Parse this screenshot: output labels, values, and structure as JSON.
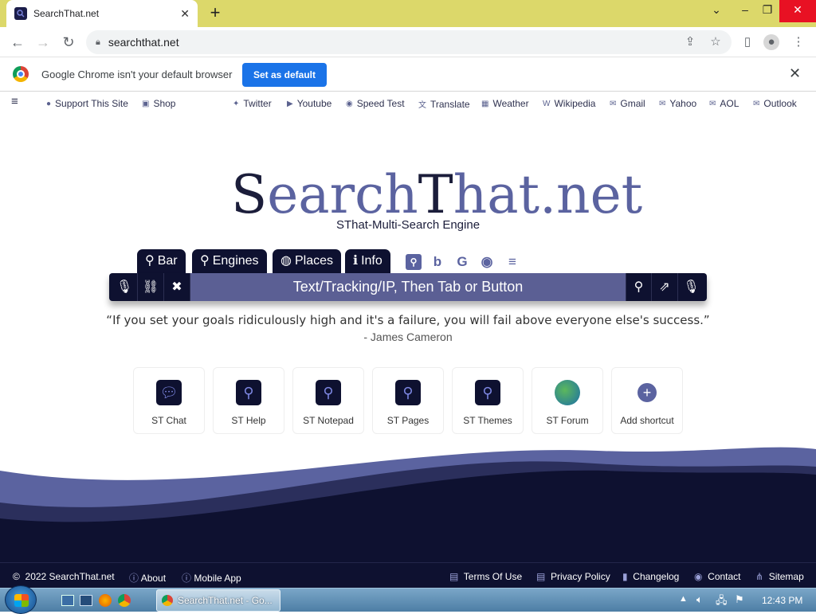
{
  "browser": {
    "tab_title": "SearchThat.net",
    "url": "searchthat.net",
    "infobar_text": "Google Chrome isn't your default browser",
    "set_default_label": "Set as default"
  },
  "topnav": {
    "left": [
      "Support This Site",
      "Shop"
    ],
    "right": [
      "Twitter",
      "Youtube",
      "Speed Test",
      "Translate",
      "Weather",
      "Wikipedia",
      "Gmail",
      "Yahoo",
      "AOL",
      "Outlook"
    ]
  },
  "site": {
    "logo_parts": [
      "S",
      "earch",
      "T",
      "hat",
      ".net"
    ],
    "tagline": "SThat-Multi-Search Engine",
    "menu_tabs": [
      "Bar",
      "Engines",
      "Places",
      "Info"
    ],
    "search_placeholder": "Text/Tracking/IP, Then Tab or Button",
    "quote": "“If you set your goals ridiculously high and it's a failure, you will fail above everyone else's success.”",
    "quote_author": "- James Cameron"
  },
  "shortcuts": [
    "ST Chat",
    "ST Help",
    "ST Notepad",
    "ST Pages",
    "ST Themes",
    "ST Forum",
    "Add shortcut"
  ],
  "footer": {
    "left": [
      "2022 SearchThat.net",
      "About",
      "Mobile App"
    ],
    "right": [
      "Terms Of Use",
      "Privacy Policy",
      "Changelog",
      "Contact",
      "Sitemap"
    ]
  },
  "taskbar": {
    "active_window": "SearchThat.net - Go...",
    "clock": "12:43 PM"
  },
  "colors": {
    "navy": "#0e1130",
    "accent": "#5b63a0",
    "chrome_frame": "#dcd86a",
    "button_blue": "#1a73e8"
  }
}
